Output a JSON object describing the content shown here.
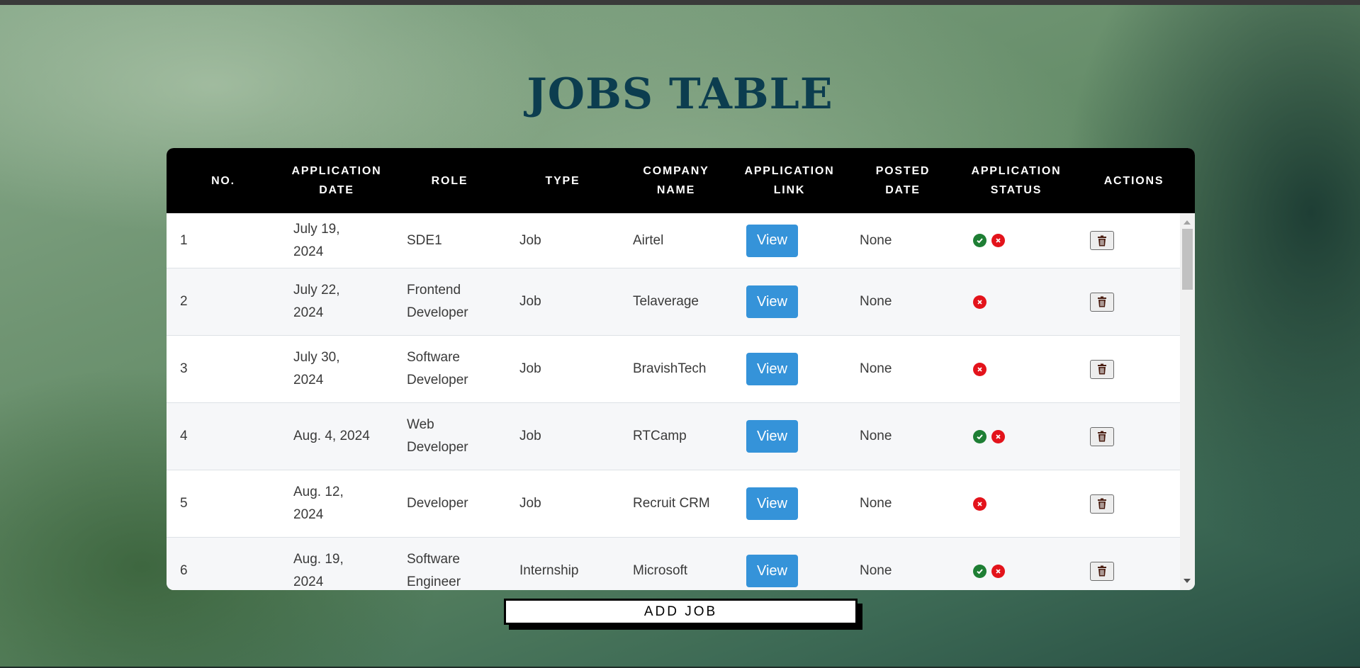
{
  "page": {
    "title": "JOBS TABLE"
  },
  "table": {
    "headers": [
      "NO.",
      "APPLICATION DATE",
      "ROLE",
      "TYPE",
      "COMPANY NAME",
      "APPLICATION LINK",
      "POSTED DATE",
      "APPLICATION STATUS",
      "ACTIONS"
    ],
    "view_label": "View",
    "rows": [
      {
        "no": "1",
        "date": "July 19, 2024",
        "role": "SDE1",
        "type": "Job",
        "company": "Airtel",
        "posted": "None",
        "status": [
          "accepted",
          "rejected"
        ]
      },
      {
        "no": "2",
        "date": "July 22, 2024",
        "role": "Frontend Developer",
        "type": "Job",
        "company": "Telaverage",
        "posted": "None",
        "status": [
          "rejected"
        ]
      },
      {
        "no": "3",
        "date": "July 30, 2024",
        "role": "Software Developer",
        "type": "Job",
        "company": "BravishTech",
        "posted": "None",
        "status": [
          "rejected"
        ]
      },
      {
        "no": "4",
        "date": "Aug. 4, 2024",
        "role": "Web Developer",
        "type": "Job",
        "company": "RTCamp",
        "posted": "None",
        "status": [
          "accepted",
          "rejected"
        ]
      },
      {
        "no": "5",
        "date": "Aug. 12, 2024",
        "role": "Developer",
        "type": "Job",
        "company": "Recruit CRM",
        "posted": "None",
        "status": [
          "rejected"
        ]
      },
      {
        "no": "6",
        "date": "Aug. 19, 2024",
        "role": "Software Engineer",
        "type": "Internship",
        "company": "Microsoft",
        "posted": "None",
        "status": [
          "accepted",
          "rejected"
        ]
      }
    ]
  },
  "icons": {
    "accepted": "check-circle-icon",
    "rejected": "x-circle-icon",
    "delete": "trash-icon"
  },
  "colors": {
    "title": "#0c3d4f",
    "header_bg": "#000000",
    "view_button": "#3593d9",
    "accepted": "#1e7e34",
    "rejected": "#e3131b"
  },
  "add_job_label": "ADD JOB"
}
